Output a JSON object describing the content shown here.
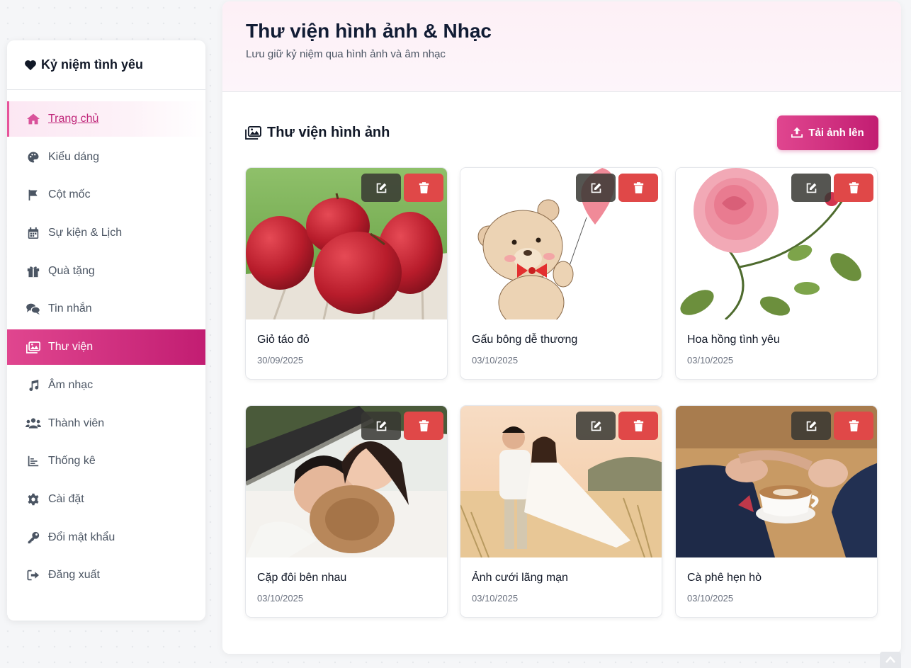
{
  "sidebar": {
    "brand": "Kỷ niệm tình yêu",
    "items": [
      {
        "label": "Trang chủ",
        "icon": "home-icon"
      },
      {
        "label": "Kiểu dáng",
        "icon": "palette-icon"
      },
      {
        "label": "Cột mốc",
        "icon": "flag-icon"
      },
      {
        "label": "Sự kiện & Lịch",
        "icon": "calendar-icon"
      },
      {
        "label": "Quà tặng",
        "icon": "gift-icon"
      },
      {
        "label": "Tin nhắn",
        "icon": "comments-icon"
      },
      {
        "label": "Thư viện",
        "icon": "images-icon"
      },
      {
        "label": "Âm nhạc",
        "icon": "music-icon"
      },
      {
        "label": "Thành viên",
        "icon": "users-icon"
      },
      {
        "label": "Thống kê",
        "icon": "chart-icon"
      },
      {
        "label": "Cài đặt",
        "icon": "gear-icon"
      },
      {
        "label": "Đổi mật khẩu",
        "icon": "key-icon"
      },
      {
        "label": "Đăng xuất",
        "icon": "logout-icon"
      }
    ],
    "active_item": "Thư viện"
  },
  "header": {
    "title": "Thư viện hình ảnh & Nhạc",
    "subtitle": "Lưu giữ kỷ niệm qua hình ảnh và âm nhạc"
  },
  "gallery": {
    "section_title": "Thư viện hình ảnh",
    "upload_label": "Tải ảnh lên",
    "photos": [
      {
        "title": "Giỏ táo đỏ",
        "date": "30/09/2025",
        "image": "red-apples"
      },
      {
        "title": "Gấu bông dễ thương",
        "date": "03/10/2025",
        "image": "teddy-bear-balloon"
      },
      {
        "title": "Hoa hồng tình yêu",
        "date": "03/10/2025",
        "image": "pink-rose"
      },
      {
        "title": "Cặp đôi bên nhau",
        "date": "03/10/2025",
        "image": "couple-hammock"
      },
      {
        "title": "Ảnh cưới lãng mạn",
        "date": "03/10/2025",
        "image": "wedding-photo"
      },
      {
        "title": "Cà phê hẹn hò",
        "date": "03/10/2025",
        "image": "coffee-date"
      }
    ]
  },
  "colors": {
    "accent": "#e0468f",
    "accent_dark": "#c21d72",
    "delete": "#e04848",
    "edit": "#3a3a36"
  }
}
